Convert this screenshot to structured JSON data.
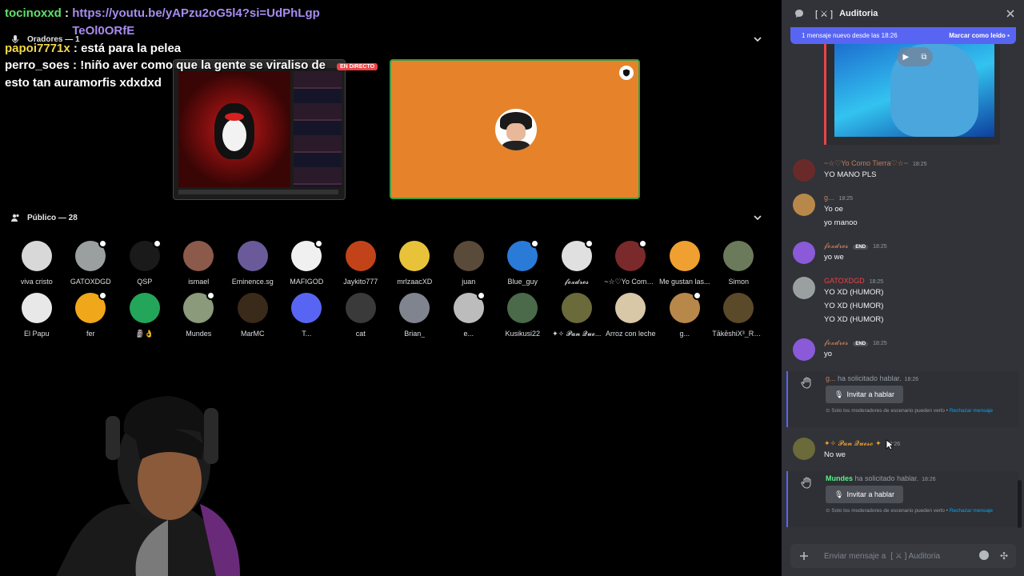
{
  "overlay_chat": {
    "msg1_user": "tocinoxxd",
    "msg1_text": "https://youtu.be/yAPzu2oG5l4?si=UdPhLgpTeOl0ORfE",
    "msg2_user": "papoi7771x",
    "msg2_text": "está para la pelea",
    "msg3_user": "perro_soes",
    "msg3_text": "!niño aver como que la gente se viraliso de esto tan auramorfis xdxdxd"
  },
  "speakers": {
    "label": "Oradores — 1",
    "live_badge": "EN DIRECTO"
  },
  "audience": {
    "label": "Público — 28",
    "row1": [
      {
        "name": "viva cristo",
        "color": "#d8d8d8"
      },
      {
        "name": "GATOXDGD",
        "color": "#9aa0a0",
        "dot": true
      },
      {
        "name": "QSP",
        "color": "#1a1a1a",
        "dot": true
      },
      {
        "name": "ismael",
        "color": "#8b5a4a"
      },
      {
        "name": "Eminence.sg",
        "color": "#6a5a9a"
      },
      {
        "name": "MAFIGOD",
        "color": "#f0f0f0",
        "dot": true
      },
      {
        "name": "Jaykito777",
        "color": "#c2431a"
      },
      {
        "name": "mrlzaacXD",
        "color": "#e8c33a"
      },
      {
        "name": "juan",
        "color": "#5a4a3a"
      },
      {
        "name": "Blue_guy",
        "color": "#2a7ad8",
        "dot": true
      },
      {
        "name": "𝓯𝓸𝔁𝓭𝓻𝓮𝓼",
        "color": "#e0e0e0",
        "dot": true
      },
      {
        "name": "~☆♡Yo Como ...",
        "color": "#7a2a2a",
        "dot": true
      },
      {
        "name": "Me gustan las...",
        "color": "#f0a030"
      },
      {
        "name": "Simon",
        "color": "#6a7a5a"
      }
    ],
    "row2": [
      {
        "name": "El Papu",
        "color": "#e8e8e8"
      },
      {
        "name": "fer",
        "color": "#f0a81a",
        "dot": true
      },
      {
        "name": "🗿👌",
        "color": "#23a55a"
      },
      {
        "name": "Mundes",
        "color": "#8a9a7a",
        "dot": true
      },
      {
        "name": "MarMC",
        "color": "#3a2a1a"
      },
      {
        "name": "T...",
        "color": "#5865f2"
      },
      {
        "name": "cat",
        "color": "#3a3a3a"
      },
      {
        "name": "Brian_",
        "color": "#80848e"
      },
      {
        "name": "e...",
        "color": "#bcbcbc",
        "dot": true
      },
      {
        "name": "Kusikusi22",
        "color": "#4a6a4a"
      },
      {
        "name": "✦✧ 𝓟𝓪𝓷 𝓠𝓾𝓮...",
        "color": "#6a6a3a"
      },
      {
        "name": "Arroz con leche",
        "color": "#d8c8a8"
      },
      {
        "name": "g...",
        "color": "#b8884a",
        "dot": true
      },
      {
        "name": "TākēshiX³_RH...",
        "color": "#5a4a2a"
      }
    ]
  },
  "panel": {
    "title": "Auditoria",
    "channel_prefix": "[ ⚔ ]",
    "banner_text": "1 mensaje nuevo desde las 18:26",
    "banner_action": "Marcar como leído",
    "messages": [
      {
        "user": "~☆♡Yo Como Tierra♡☆~",
        "color": "#c27c5a",
        "ts": "18:25",
        "lines": [
          "YO MANO PLS"
        ]
      },
      {
        "user": "g...",
        "color": "#c27c5a",
        "ts": "18:25",
        "lines": [
          "Yo oe",
          "yo manoo"
        ]
      },
      {
        "user": "𝓯𝓸𝔁𝓭𝓻𝓮𝓼",
        "color": "#c27c5a",
        "ts": "18:25",
        "tag": "END",
        "lines": [
          "yo we"
        ]
      },
      {
        "user": "GATOXDGD",
        "color": "#ed4245",
        "ts": "18:25",
        "lines": [
          "YO XD (HUMOR)",
          "YO XD (HUMOR)",
          "YO XD (HUMOR)"
        ]
      },
      {
        "user": "𝓯𝓸𝔁𝓭𝓻𝓮𝓼",
        "color": "#c27c5a",
        "ts": "18:25",
        "tag": "END",
        "lines": [
          "yo"
        ]
      }
    ],
    "request1": {
      "user": "g...",
      "text": "ha solicitado hablar.",
      "ts": "18:26"
    },
    "request2": {
      "user": "Mundes",
      "text": "ha solicitado hablar.",
      "ts": "18:26"
    },
    "invite_label": "Invitar a hablar",
    "mod_note": "Solo los moderadores de escenario pueden verlo •",
    "mod_link": "Rechazar mensaje",
    "pan_msg": {
      "user": "✦✧ 𝓟𝓪𝓷 𝓠𝓾𝓮𝓼𝓸 ✦",
      "ts": "18:26",
      "line": "No we"
    },
    "composer_placeholder": "Enviar mensaje a",
    "composer_channel": "[ ⚔ ]   Auditoria"
  }
}
